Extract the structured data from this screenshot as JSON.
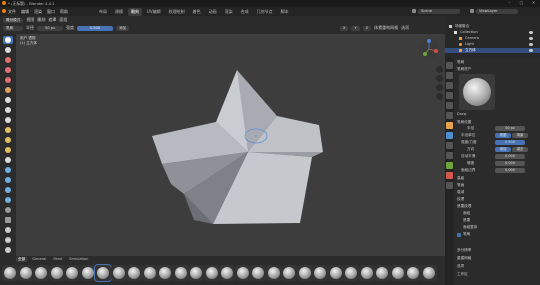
{
  "app": {
    "title": "* (无标题) - Blender 4.4.1"
  },
  "menu": [
    "文件",
    "编辑",
    "渲染",
    "窗口",
    "帮助"
  ],
  "workspaces": [
    {
      "label": "布局"
    },
    {
      "label": "建模"
    },
    {
      "label": "雕刻",
      "active": true
    },
    {
      "label": "UV编辑"
    },
    {
      "label": "纹理绘制"
    },
    {
      "label": "着色"
    },
    {
      "label": "动画"
    },
    {
      "label": "渲染"
    },
    {
      "label": "合成"
    },
    {
      "label": "几何节点"
    },
    {
      "label": "脚本"
    }
  ],
  "topbar_right": {
    "scene_label": "Scene",
    "viewlayer_label": "ViewLayer"
  },
  "tool_header": {
    "mode": "雕刻模式",
    "view": "视图",
    "sculpt": "雕刻",
    "mask": "遮罩",
    "face_sets": "面组",
    "brush_label": "笔刷",
    "radius_label": "半径",
    "radius_value": "50 px",
    "strength_label": "强度",
    "strength_value": "0.500",
    "direction": "添加",
    "symmetry_x": "X",
    "symmetry_y": "Y",
    "symmetry_z": "Z",
    "remesh": "体素重构网格",
    "options": "选项"
  },
  "viewport_info": {
    "line1": "用户 透视",
    "line2": "(1) 立方体"
  },
  "asset_shelf": {
    "tabs": [
      {
        "label": "全部",
        "active": true
      },
      {
        "label": "General"
      },
      {
        "label": "Paint"
      },
      {
        "label": "Simulation"
      }
    ],
    "brush_count": 28
  },
  "outliner": {
    "title": "场景集合",
    "rows": [
      {
        "label": "场景集合",
        "indent": 0
      },
      {
        "label": "Collection",
        "indent": 1
      },
      {
        "label": "Camera",
        "indent": 2
      },
      {
        "label": "Light",
        "indent": 2
      },
      {
        "label": "立方体",
        "indent": 2
      }
    ]
  },
  "properties": {
    "section_brush": "笔刷",
    "section_brush_assets": "笔刷资产",
    "brush_name": "Draw",
    "section_brush_settings": "笔刷设置",
    "rows": [
      {
        "label": "半径",
        "value": "50 px"
      },
      {
        "label": "半径单位",
        "value": "视图",
        "value2": "场景"
      },
      {
        "label": "强度/力度",
        "value": "0.500"
      },
      {
        "label": "方向",
        "value": "添加",
        "value2": "减去"
      },
      {
        "label": "自动平滑",
        "value": "0.000"
      },
      {
        "label": "硬度",
        "value": "0.000"
      },
      {
        "label": "面组边界",
        "value": "0.000"
      }
    ],
    "collapsed": [
      "高级",
      "笔画",
      "衰减",
      "纹理",
      "遮罩纹理",
      "笔刷"
    ],
    "subsections": [
      "面组",
      "遮罩",
      "面组整体"
    ],
    "bottom": [
      "多分辨率",
      "重建网格",
      "选项",
      "工作区"
    ]
  },
  "colors": {
    "accent": "#4772b3",
    "viewport_bg": "#3d3d3d",
    "panel": "#2b2b2b",
    "cursor_ring": "#5a8fd6"
  }
}
